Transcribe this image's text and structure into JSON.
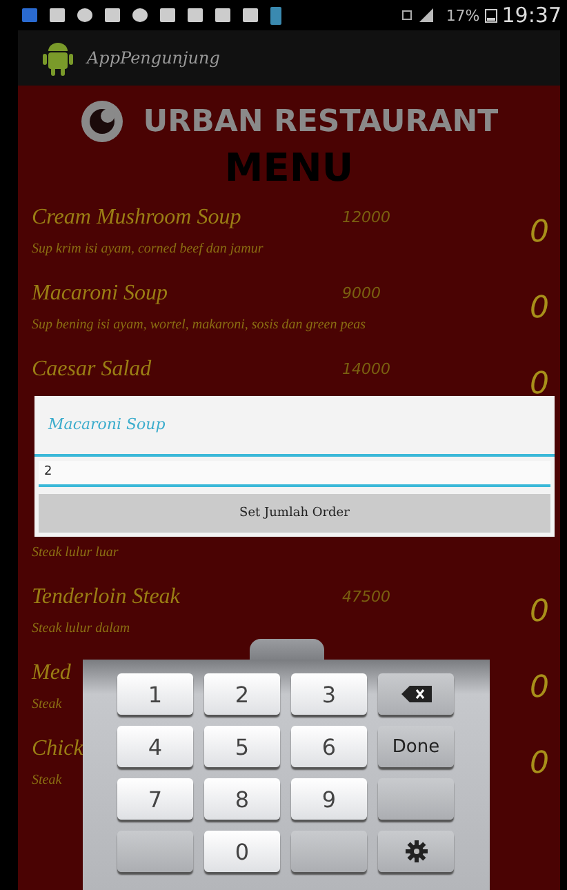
{
  "status_bar": {
    "battery": "17%",
    "time": "19:37"
  },
  "app_bar": {
    "title": "AppPengunjung"
  },
  "header": {
    "restaurant": "URBAN RESTAURANT",
    "title": "MENU"
  },
  "items": [
    {
      "name": "Cream Mushroom Soup",
      "price": "12000",
      "description": "Sup krim isi ayam, corned beef dan jamur",
      "quantity": "0"
    },
    {
      "name": "Macaroni Soup",
      "price": "9000",
      "description": "Sup bening isi ayam, wortel, makaroni, sosis dan green peas",
      "quantity": "0"
    },
    {
      "name": "Caesar Salad",
      "price": "14000",
      "quantity": "0"
    },
    {
      "description": "Steak lulur luar"
    },
    {
      "name": "Tenderloin Steak",
      "price": "47500",
      "description": "Steak lulur dalam",
      "quantity": "0"
    },
    {
      "name": "Med",
      "description": "Steak",
      "quantity": "0"
    },
    {
      "name": "Chick",
      "description": "Steak",
      "quantity": "0"
    }
  ],
  "dialog": {
    "title": "Macaroni Soup",
    "value": "2",
    "button": "Set Jumlah Order"
  },
  "keyboard": {
    "keys": [
      {
        "kind": "char",
        "label": "1"
      },
      {
        "kind": "char",
        "label": "2"
      },
      {
        "kind": "char",
        "label": "3"
      },
      {
        "kind": "backspace"
      },
      {
        "kind": "char",
        "label": "4"
      },
      {
        "kind": "char",
        "label": "5"
      },
      {
        "kind": "char",
        "label": "6"
      },
      {
        "kind": "action",
        "label": "Done"
      },
      {
        "kind": "char",
        "label": "7"
      },
      {
        "kind": "char",
        "label": "8"
      },
      {
        "kind": "char",
        "label": "9"
      },
      {
        "kind": "blank"
      },
      {
        "kind": "blank"
      },
      {
        "kind": "char",
        "label": "0"
      },
      {
        "kind": "blank"
      },
      {
        "kind": "settings"
      }
    ]
  }
}
